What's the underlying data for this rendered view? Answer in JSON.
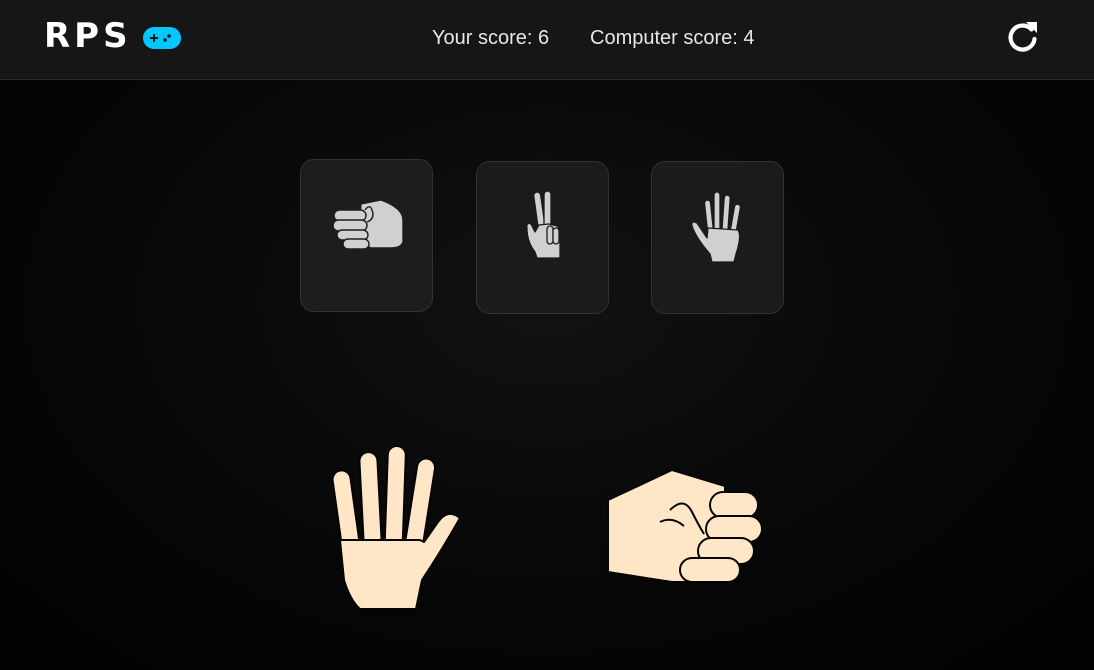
{
  "header": {
    "logo_text": "RPS",
    "logo_icon": "gamepad-icon",
    "logo_icon_color": "#00c8ff",
    "your_score_label": "Your score: 6",
    "computer_score_label": "Computer score: 4",
    "reset_icon": "reset-icon"
  },
  "choices": [
    {
      "name": "rock",
      "icon": "fist-icon"
    },
    {
      "name": "scissors",
      "icon": "peace-hand-icon"
    },
    {
      "name": "paper",
      "icon": "open-hand-icon"
    }
  ],
  "result": {
    "player_choice": "paper",
    "computer_choice": "rock"
  },
  "colors": {
    "icon_gray": "#cfd0d2",
    "hand_skin": "#ffe6c7",
    "background": "#050505"
  }
}
